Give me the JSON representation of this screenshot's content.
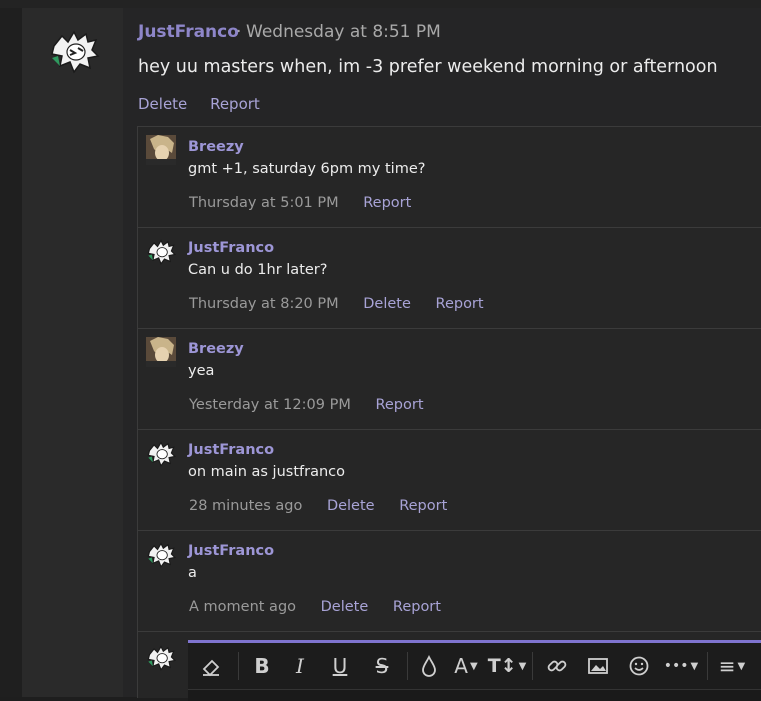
{
  "post": {
    "author": "JustFranco",
    "separator": "·",
    "time": "Wednesday at 8:51 PM",
    "body": "hey uu masters when, im -3 prefer weekend morning or afternoon",
    "actions": [
      "Delete",
      "Report"
    ]
  },
  "comments": [
    {
      "author": "Breezy",
      "body": "gmt +1, saturday 6pm my time?",
      "time": "Thursday at 5:01 PM",
      "actions": [
        "Report"
      ],
      "avatar": "breezy-avatar"
    },
    {
      "author": "JustFranco",
      "body": "Can u do 1hr later?",
      "time": "Thursday at 8:20 PM",
      "actions": [
        "Delete",
        "Report"
      ],
      "avatar": "justfranco-avatar"
    },
    {
      "author": "Breezy",
      "body": "yea",
      "time": "Yesterday at 12:09 PM",
      "actions": [
        "Report"
      ],
      "avatar": "breezy-avatar"
    },
    {
      "author": "JustFranco",
      "body": "on main as justfranco",
      "time": "28 minutes ago",
      "actions": [
        "Delete",
        "Report"
      ],
      "avatar": "justfranco-avatar"
    },
    {
      "author": "JustFranco",
      "body": "a",
      "time": "A moment ago",
      "actions": [
        "Delete",
        "Report"
      ],
      "avatar": "justfranco-avatar"
    }
  ],
  "editor": {
    "toolbar": [
      "clear-format-icon",
      "bold-icon",
      "italic-icon",
      "underline-icon",
      "strikethrough-icon",
      "text-color-icon",
      "font-family-icon",
      "font-size-icon",
      "link-icon",
      "image-icon",
      "emoji-icon",
      "more-options-icon",
      "align-icon"
    ],
    "glyphs": {
      "bold": "B",
      "italic": "I",
      "underline": "U",
      "strike": "S",
      "font_family": "A",
      "font_size": "T↕",
      "more": "•••",
      "align": "≡"
    }
  },
  "colors": {
    "accent": "#8e86c9",
    "link": "#a8a3d6",
    "editor_border": "#7f74cf"
  }
}
